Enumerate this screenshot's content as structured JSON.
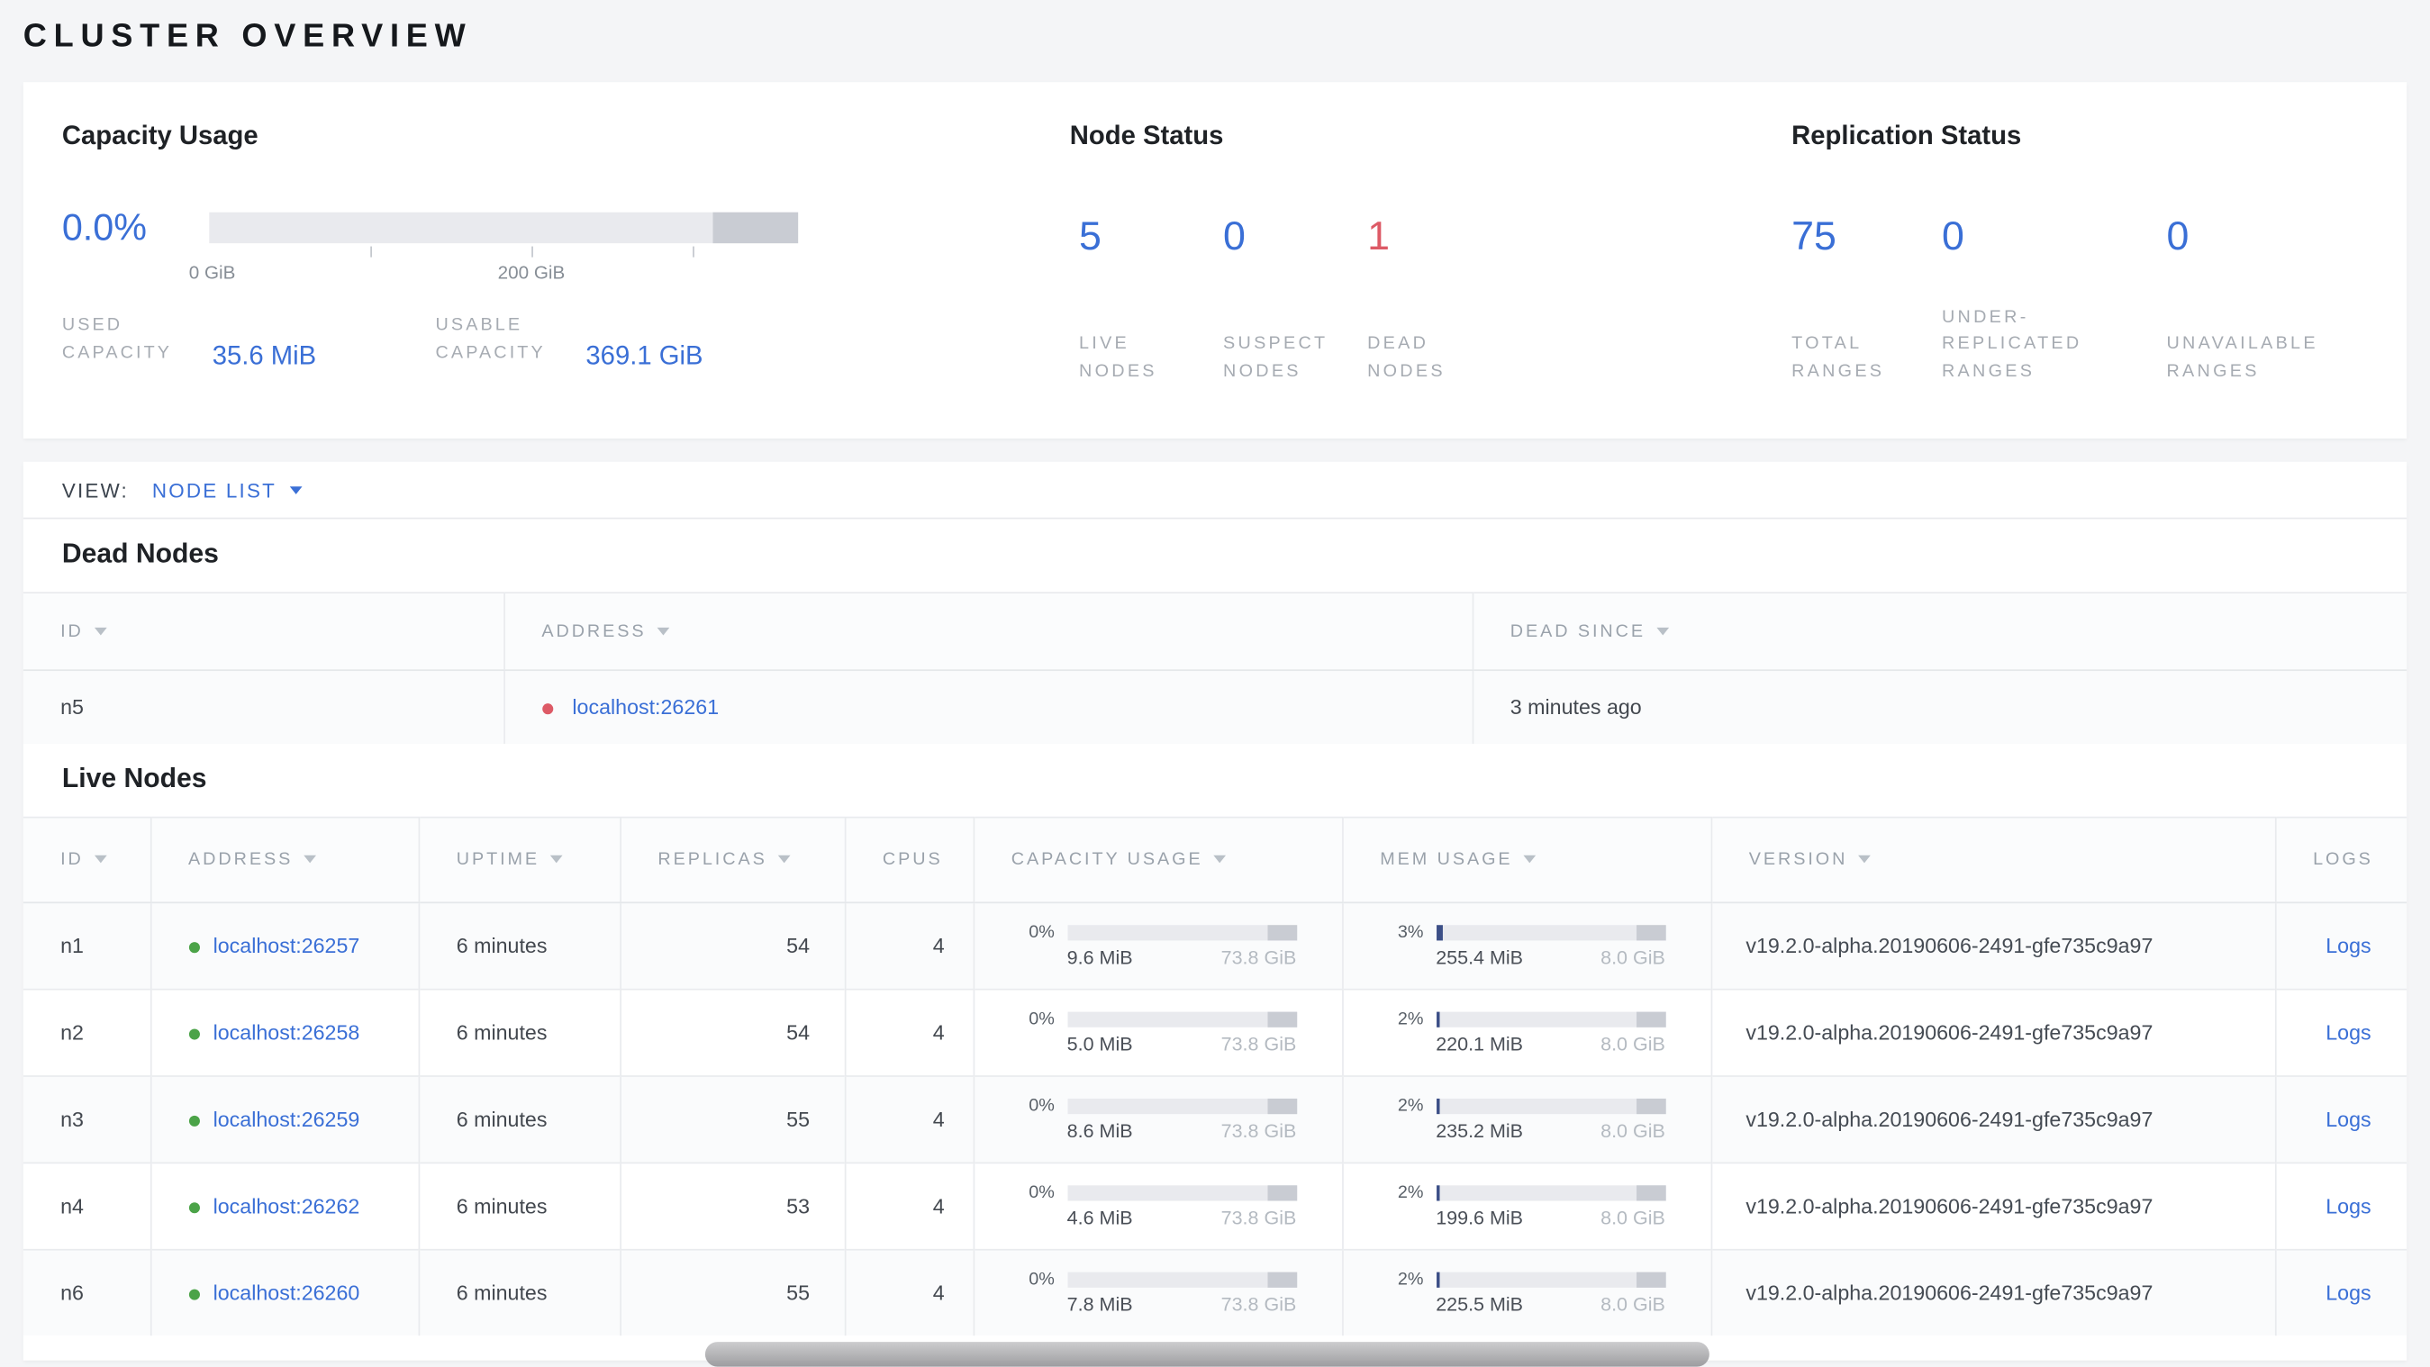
{
  "colors": {
    "accent_blue": "#3a6fd6",
    "danger_red": "#dd5a66",
    "ok_green": "#4ba348",
    "bar_used_blue": "#3c4f87",
    "bar_track": "#e9eaee",
    "bar_dark": "#c9ccd3"
  },
  "page": {
    "title": "CLUSTER OVERVIEW"
  },
  "summary": {
    "capacity": {
      "title": "Capacity Usage",
      "percent": "0.0%",
      "axis": {
        "tick_0": "0 GiB",
        "tick_200": "200 GiB"
      },
      "used": {
        "label": "USED CAPACITY",
        "value": "35.6 MiB"
      },
      "usable": {
        "label": "USABLE CAPACITY",
        "value": "369.1 GiB"
      }
    },
    "node_status": {
      "title": "Node Status",
      "stats": [
        {
          "value": "5",
          "label": "LIVE NODES"
        },
        {
          "value": "0",
          "label": "SUSPECT NODES"
        },
        {
          "value": "1",
          "label": "DEAD NODES"
        }
      ]
    },
    "replication": {
      "title": "Replication Status",
      "stats": [
        {
          "value": "75",
          "label": "TOTAL RANGES"
        },
        {
          "value": "0",
          "label": "UNDER-REPLICATED RANGES"
        },
        {
          "value": "0",
          "label": "UNAVAILABLE RANGES"
        }
      ]
    }
  },
  "view_bar": {
    "label": "VIEW:",
    "selected": "NODE LIST"
  },
  "dead_nodes": {
    "title": "Dead Nodes",
    "columns": {
      "id": "ID",
      "address": "ADDRESS",
      "dead_since": "DEAD SINCE"
    },
    "rows": [
      {
        "id": "n5",
        "address": "localhost:26261",
        "dead_since": "3 minutes ago"
      }
    ]
  },
  "live_nodes": {
    "title": "Live Nodes",
    "columns": {
      "id": "ID",
      "address": "ADDRESS",
      "uptime": "UPTIME",
      "replicas": "REPLICAS",
      "cpus": "CPUS",
      "capacity": "CAPACITY USAGE",
      "mem": "MEM USAGE",
      "version": "VERSION",
      "logs": "LOGS"
    },
    "rows": [
      {
        "id": "n1",
        "address": "localhost:26257",
        "uptime": "6 minutes",
        "replicas": "54",
        "cpus": "4",
        "capacity": {
          "percent": "0%",
          "pct_num": 0,
          "used": "9.6 MiB",
          "total": "73.8 GiB"
        },
        "mem": {
          "percent": "3%",
          "pct_num": 3,
          "used": "255.4 MiB",
          "total": "8.0 GiB"
        },
        "version": "v19.2.0-alpha.20190606-2491-gfe735c9a97",
        "logs_label": "Logs"
      },
      {
        "id": "n2",
        "address": "localhost:26258",
        "uptime": "6 minutes",
        "replicas": "54",
        "cpus": "4",
        "capacity": {
          "percent": "0%",
          "pct_num": 0,
          "used": "5.0 MiB",
          "total": "73.8 GiB"
        },
        "mem": {
          "percent": "2%",
          "pct_num": 2,
          "used": "220.1 MiB",
          "total": "8.0 GiB"
        },
        "version": "v19.2.0-alpha.20190606-2491-gfe735c9a97",
        "logs_label": "Logs"
      },
      {
        "id": "n3",
        "address": "localhost:26259",
        "uptime": "6 minutes",
        "replicas": "55",
        "cpus": "4",
        "capacity": {
          "percent": "0%",
          "pct_num": 0,
          "used": "8.6 MiB",
          "total": "73.8 GiB"
        },
        "mem": {
          "percent": "2%",
          "pct_num": 2,
          "used": "235.2 MiB",
          "total": "8.0 GiB"
        },
        "version": "v19.2.0-alpha.20190606-2491-gfe735c9a97",
        "logs_label": "Logs"
      },
      {
        "id": "n4",
        "address": "localhost:26262",
        "uptime": "6 minutes",
        "replicas": "53",
        "cpus": "4",
        "capacity": {
          "percent": "0%",
          "pct_num": 0,
          "used": "4.6 MiB",
          "total": "73.8 GiB"
        },
        "mem": {
          "percent": "2%",
          "pct_num": 2,
          "used": "199.6 MiB",
          "total": "8.0 GiB"
        },
        "version": "v19.2.0-alpha.20190606-2491-gfe735c9a97",
        "logs_label": "Logs"
      },
      {
        "id": "n6",
        "address": "localhost:26260",
        "uptime": "6 minutes",
        "replicas": "55",
        "cpus": "4",
        "capacity": {
          "percent": "0%",
          "pct_num": 0,
          "used": "7.8 MiB",
          "total": "73.8 GiB"
        },
        "mem": {
          "percent": "2%",
          "pct_num": 2,
          "used": "225.5 MiB",
          "total": "8.0 GiB"
        },
        "version": "v19.2.0-alpha.20190606-2491-gfe735c9a97",
        "logs_label": "Logs"
      }
    ]
  }
}
